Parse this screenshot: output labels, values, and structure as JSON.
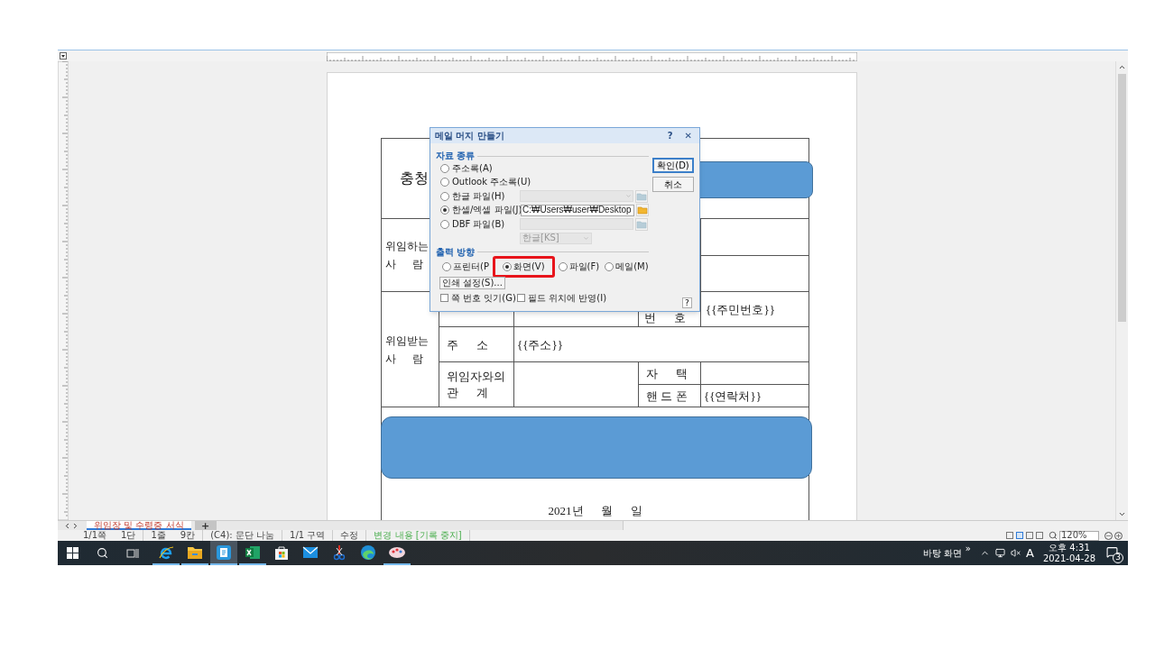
{
  "document": {
    "title": "충청",
    "delegator": {
      "label_lines": [
        "위임하는",
        "사      람"
      ]
    },
    "delegate": {
      "label_lines": [
        "위임받는",
        "사      람"
      ],
      "id_label": "번      호",
      "id_value": "{{주민번호}}",
      "address_label": "주      소",
      "address_value": "{{주소}}",
      "relation_label_lines": [
        "위임자와의",
        "관      계"
      ],
      "home_label": "자      택",
      "mobile_label": "핸 드 폰",
      "mobile_value": "{{연락처}}"
    },
    "date": "2021년      월      일"
  },
  "dialog": {
    "title": "메일 머지 만들기",
    "help": "?",
    "close": "✕",
    "source_group": "자료 종류",
    "sources": [
      {
        "label": "주소록(A)",
        "selected": false,
        "kind": "plain"
      },
      {
        "label": "Outlook 주소록(U)",
        "selected": false,
        "kind": "plain"
      },
      {
        "label": "한글 파일(H)",
        "selected": false,
        "kind": "dropdown",
        "disabled": true
      },
      {
        "label": "한셀/엑셀 파일(J)",
        "selected": true,
        "kind": "path",
        "disabled": false,
        "value": "C:₩Users₩user₩Desktop"
      },
      {
        "label": "DBF 파일(B)",
        "selected": false,
        "kind": "field",
        "disabled": true
      }
    ],
    "encoding": "한글[KS]",
    "output_group": "출력 방향",
    "outputs": [
      {
        "label": "프린터(P",
        "selected": false,
        "highlighted": false
      },
      {
        "label": "화면(V)",
        "selected": true,
        "highlighted": true
      },
      {
        "label": "파일(F)",
        "selected": false,
        "highlighted": false
      },
      {
        "label": "메일(M)",
        "selected": false,
        "highlighted": false
      }
    ],
    "print_setup": "인쇄 설정(S)...",
    "options": [
      {
        "label": "쪽 번호 잇기(G)",
        "checked": false
      },
      {
        "label": "필드 위치에 반영(I)",
        "checked": false
      }
    ],
    "ok": "확인(D)",
    "cancel": "취소",
    "help_button": "?"
  },
  "sheet_tabs": [
    {
      "label": "위임장 및 수령증 서식",
      "selected": true
    }
  ],
  "add_tab": "+",
  "status_bar": {
    "groups": [
      [
        "1/1쪽",
        "1단"
      ],
      [
        "1줄",
        "9칸"
      ],
      [
        "(C4): 문단 나눔"
      ],
      [
        "1/1 구역"
      ],
      [
        "수정"
      ]
    ],
    "track_changes": "변경 내용 [기록 중지]",
    "zoom": "120%"
  },
  "taskbar": {
    "apps": [
      {
        "kind": "ie",
        "selected": false,
        "running": true
      },
      {
        "kind": "explorer",
        "selected": false,
        "running": true
      },
      {
        "kind": "hancom",
        "selected": true,
        "running": true
      },
      {
        "kind": "excel",
        "selected": false,
        "running": true
      },
      {
        "kind": "store",
        "selected": false,
        "running": false
      },
      {
        "kind": "mail",
        "selected": false,
        "running": false
      },
      {
        "kind": "snip",
        "selected": false,
        "running": false
      },
      {
        "kind": "edge",
        "selected": false,
        "running": false
      },
      {
        "kind": "paint",
        "selected": false,
        "running": true
      }
    ],
    "desktop": "바탕 화면",
    "chevron": "»",
    "ime": "A",
    "time": "오후 4:31",
    "date": "2021-04-28",
    "notifications": "3"
  }
}
